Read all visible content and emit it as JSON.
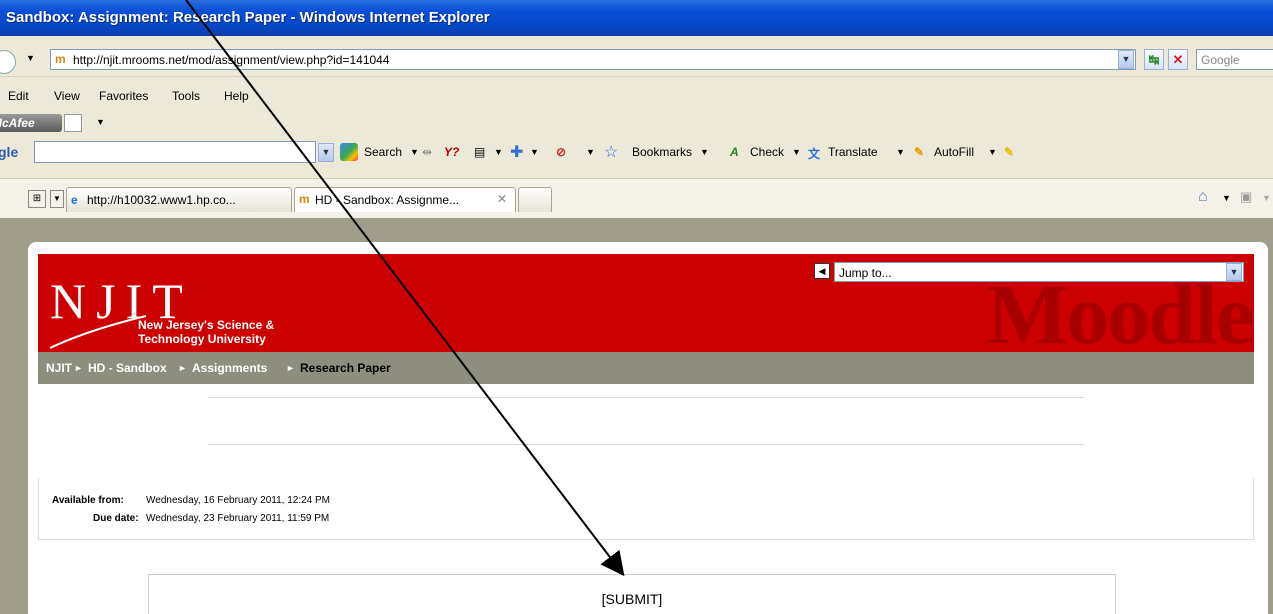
{
  "window": {
    "title": "Sandbox: Assignment: Research Paper - Windows Internet Explorer"
  },
  "address": {
    "url": "http://njit.mrooms.net/mod/assignment/view.php?id=141044",
    "search_placeholder": "Google"
  },
  "menu": {
    "items": [
      "Edit",
      "View",
      "Favorites",
      "Tools",
      "Help"
    ]
  },
  "mcafee": {
    "label": "McAfee"
  },
  "google_toolbar": {
    "logo": "gle",
    "search_label": "Search",
    "bookmarks_label": "Bookmarks",
    "check_label": "Check",
    "translate_label": "Translate",
    "autofill_label": "AutoFill"
  },
  "tabs": [
    {
      "label": "http://h10032.www1.hp.co..."
    },
    {
      "label": "HD - Sandbox: Assignme..."
    }
  ],
  "page": {
    "logo": "NJIT",
    "tagline1": "New Jersey's Science &",
    "tagline2": "Technology University",
    "brand": "Moodle",
    "jump_to": "Jump to...",
    "breadcrumb": [
      "NJIT",
      "HD - Sandbox",
      "Assignments",
      "Research Paper"
    ],
    "available_label": "Available from:",
    "available_value": "Wednesday, 16 February 2011, 12:24 PM",
    "due_label": "Due date:",
    "due_value": "Wednesday, 23 February 2011, 11:59 PM",
    "submit_text": "[SUBMIT]"
  },
  "colors": {
    "header_red": "#cc0000",
    "navbar": "#8e8e7e",
    "titlebar": "#0a4fd6"
  }
}
